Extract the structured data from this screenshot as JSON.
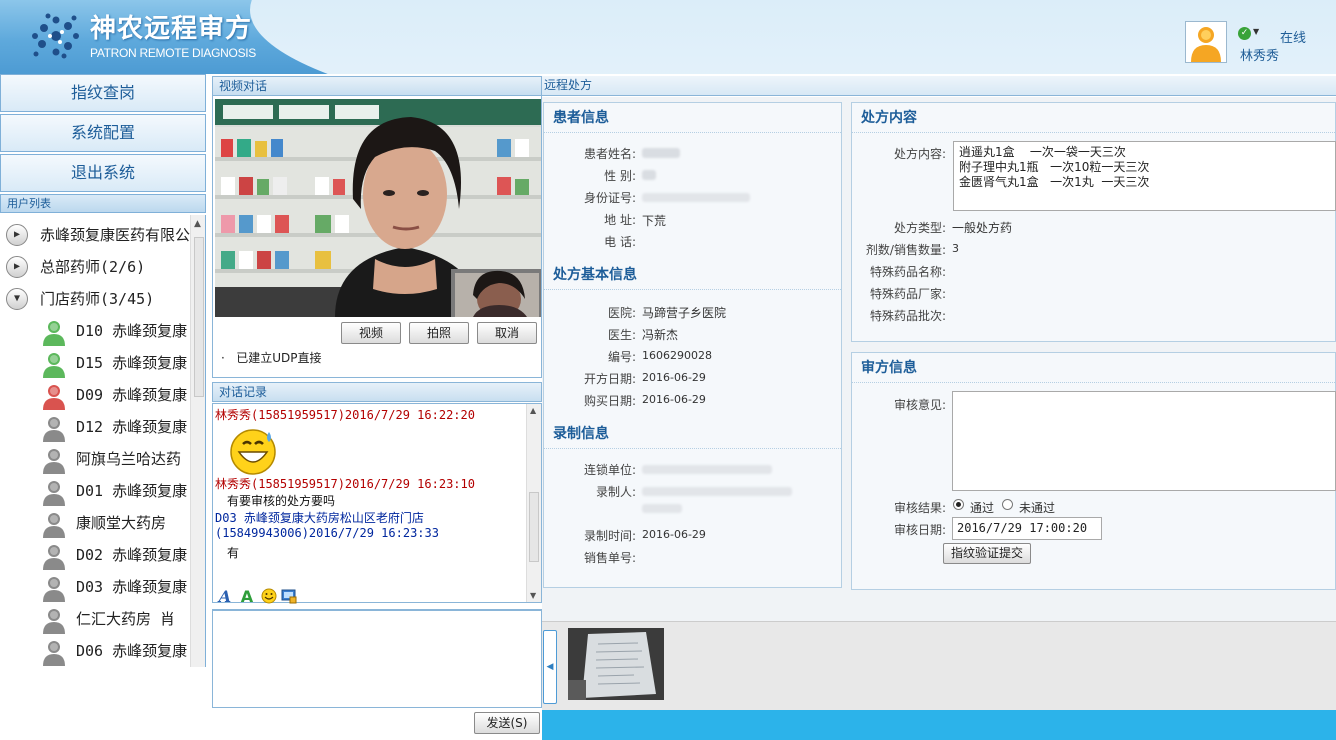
{
  "header": {
    "brand_title": "神农远程审方",
    "brand_subtitle": "PATRON REMOTE DIAGNOSIS",
    "status": "在线",
    "username": "林秀秀",
    "accent_color": "#4d9bd3"
  },
  "nav": {
    "buttons": [
      "指纹查岗",
      "系统配置",
      "退出系统"
    ],
    "user_list_title": "用户列表"
  },
  "user_tree": {
    "groups": [
      {
        "label": "赤峰颈复康医药有限公",
        "expanded": false
      },
      {
        "label": "总部药师(2/6)",
        "expanded": false
      },
      {
        "label": "门店药师(3/45)",
        "expanded": true
      }
    ],
    "members": [
      {
        "label": "D10  赤峰颈复康",
        "status": "online"
      },
      {
        "label": "D15 赤峰颈复康",
        "status": "online"
      },
      {
        "label": "D09  赤峰颈复康",
        "status": "busy"
      },
      {
        "label": "D12  赤峰颈复康",
        "status": "offline"
      },
      {
        "label": "阿旗乌兰哈达药",
        "status": "offline"
      },
      {
        "label": "D01  赤峰颈复康",
        "status": "offline"
      },
      {
        "label": "康顺堂大药房  ",
        "status": "offline"
      },
      {
        "label": "D02  赤峰颈复康",
        "status": "offline"
      },
      {
        "label": "D03  赤峰颈复康",
        "status": "offline"
      },
      {
        "label": "仁汇大药房  肖",
        "status": "offline"
      },
      {
        "label": "D06  赤峰颈复康",
        "status": "offline"
      }
    ]
  },
  "video": {
    "title": "视频对话",
    "btn_video": "视频",
    "btn_photo": "拍照",
    "btn_cancel": "取消",
    "connection_status": "已建立UDP直接"
  },
  "chat": {
    "title": "对话记录",
    "lines": [
      {
        "text": "林秀秀(15851959517)2016/7/29 16:22:20",
        "kind": "sender-self"
      },
      {
        "text": "林秀秀(15851959517)2016/7/29 16:23:10",
        "kind": "sender-self"
      },
      {
        "text": "有要审核的处方要吗",
        "kind": "message"
      },
      {
        "text": "D03  赤峰颈复康大药房松山区老府门店",
        "kind": "sender-other"
      },
      {
        "text": "(15849943006)2016/7/29 16:23:33",
        "kind": "sender-other"
      },
      {
        "text": "有",
        "kind": "message"
      }
    ],
    "send_label": "发送(S)"
  },
  "prescription": {
    "panel_title": "远程处方",
    "patient": {
      "heading": "患者信息",
      "labels": {
        "name": "患者姓名:",
        "sex": "性 别:",
        "id": "身份证号:",
        "address": "地 址:",
        "phone": "电 话:"
      },
      "address": "下荒"
    },
    "basic": {
      "heading": "处方基本信息",
      "labels": {
        "hospital": "医院:",
        "doctor": "医生:",
        "number": "编号:",
        "issue_date": "开方日期:",
        "buy_date": "购买日期:"
      },
      "hospital": "马蹄营子乡医院",
      "doctor": "冯新杰",
      "number": "1606290028",
      "issue_date": "2016-06-29",
      "buy_date": "2016-06-29"
    },
    "record": {
      "heading": "录制信息",
      "labels": {
        "chain": "连锁单位:",
        "recorder": "录制人:",
        "time": "录制时间:",
        "sale_no": "销售单号:"
      },
      "time": "2016-06-29"
    },
    "content": {
      "heading": "处方内容",
      "labels": {
        "content": "处方内容:",
        "type": "处方类型:",
        "count": "剂数/销售数量:",
        "drug_name": "特殊药品名称:",
        "drug_maker": "特殊药品厂家:",
        "drug_batch": "特殊药品批次:"
      },
      "items": "逍遥丸1盒    一次一袋一天三次\n附子理中丸1瓶   一次10粒一天三次\n金匮肾气丸1盒   一次1丸  一天三次",
      "type": "一般处方药",
      "count": "3"
    },
    "review": {
      "heading": "审方信息",
      "labels": {
        "opinion": "审核意见:",
        "result": "审核结果:",
        "date": "审核日期:"
      },
      "pass": "通过",
      "fail": "未通过",
      "date": "2016/7/29 17:00:20",
      "submit": "指纹验证提交"
    }
  }
}
